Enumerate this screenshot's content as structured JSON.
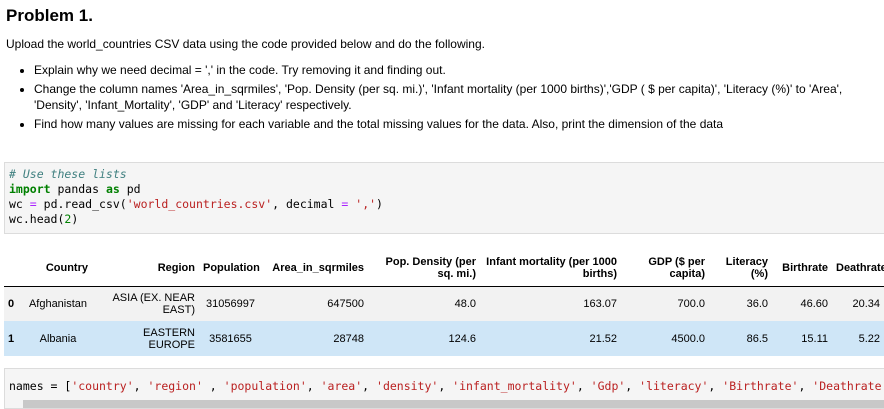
{
  "title": "Problem 1.",
  "intro": "Upload the world_countries CSV data using the code provided below and do the following.",
  "bullets": [
    "Explain why we need decimal = ',' in the code. Try removing it and finding out.",
    "Change the column names 'Area_in_sqrmiles', 'Pop. Density (per sq. mi.)', 'Infant mortality (per 1000 births)','GDP ( $ per capita)', 'Literacy (%)' to 'Area', 'Density', 'Infant_Mortality', 'GDP' and 'Literacy' respectively.",
    "Find how many values are missing for each variable and the total missing values for the data. Also, print the dimension of the data"
  ],
  "code_cell": {
    "comment": "# Use these lists",
    "import_kw": "import",
    "import_mod": " pandas ",
    "as_kw": "as",
    "import_alias": " pd",
    "line3_a": "wc ",
    "line3_eq": "=",
    "line3_b": " pd.read_csv(",
    "line3_str1": "'world_countries.csv'",
    "line3_c": ", decimal ",
    "line3_eq2": "=",
    "line3_d": " ",
    "line3_str2": "','",
    "line3_e": ")",
    "line4_a": "wc.head(",
    "line4_num": "2",
    "line4_b": ")"
  },
  "table": {
    "columns": [
      "",
      "Country",
      "Region",
      "Population",
      "Area_in_sqrmiles",
      "Pop. Density (per sq. mi.)",
      "Infant mortality (per 1000 births)",
      "GDP ($ per capita)",
      "Literacy (%)",
      "Birthrate",
      "Deathrate"
    ],
    "rows": [
      [
        "0",
        "Afghanistan",
        "ASIA (EX. NEAR EAST)",
        "31056997",
        "647500",
        "48.0",
        "163.07",
        "700.0",
        "36.0",
        "46.60",
        "20.34"
      ],
      [
        "1",
        "Albania",
        "EASTERN EUROPE",
        "3581655",
        "28748",
        "124.6",
        "21.52",
        "4500.0",
        "86.5",
        "15.11",
        "5.22"
      ]
    ]
  },
  "code_cell2": {
    "line": "names = ['country', 'region' , 'population', 'area', 'density', 'infant_mortality', 'Gdp', 'literacy', 'Birthrate', 'Deathrate"
  }
}
